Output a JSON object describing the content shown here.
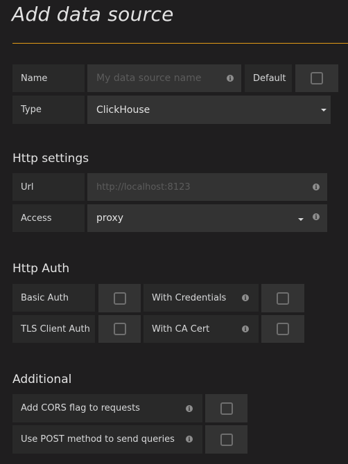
{
  "page": {
    "title": "Add data source",
    "accent_color": "#e29b17"
  },
  "general": {
    "name_label": "Name",
    "name_placeholder": "My data source name",
    "name_value": "",
    "default_label": "Default",
    "default_checked": false,
    "type_label": "Type",
    "type_value": "ClickHouse"
  },
  "http": {
    "heading": "Http settings",
    "url_label": "Url",
    "url_placeholder": "http://localhost:8123",
    "access_label": "Access",
    "access_value": "proxy"
  },
  "auth": {
    "heading": "Http Auth",
    "basic_auth": "Basic Auth",
    "with_credentials": "With Credentials",
    "tls_client_auth": "TLS Client Auth",
    "with_ca_cert": "With CA Cert"
  },
  "additional": {
    "heading": "Additional",
    "cors": "Add CORS flag to requests",
    "post": "Use POST method to send queries"
  },
  "icons": {
    "info": "info-circle-icon",
    "dropdown": "caret-down-icon",
    "checkbox": "checkbox-unchecked"
  }
}
